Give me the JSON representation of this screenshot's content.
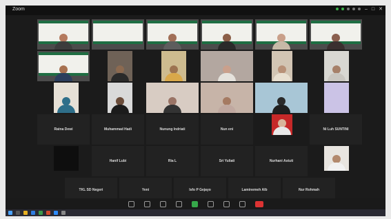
{
  "app": {
    "title": "Zoom"
  },
  "participants": [
    {
      "id": "p1",
      "name": ""
    },
    {
      "id": "p2",
      "name": ""
    },
    {
      "id": "p3",
      "name": ""
    },
    {
      "id": "p4",
      "name": ""
    },
    {
      "id": "p5",
      "name": ""
    },
    {
      "id": "p6",
      "name": ""
    },
    {
      "id": "p7",
      "name": ""
    },
    {
      "id": "p8",
      "name": ""
    },
    {
      "id": "p9",
      "name": ""
    },
    {
      "id": "p10",
      "name": ""
    },
    {
      "id": "p11",
      "name": ""
    },
    {
      "id": "p12",
      "name": ""
    },
    {
      "id": "p13",
      "name": ""
    },
    {
      "id": "p14",
      "name": ""
    },
    {
      "id": "p15",
      "name": ""
    },
    {
      "id": "p16",
      "name": ""
    },
    {
      "id": "p17",
      "name": ""
    },
    {
      "id": "p18",
      "name": ""
    }
  ],
  "name_only": [
    "Ratna Dewi",
    "Muhammad Hadi",
    "Nunung Indriati",
    "Nun eni",
    "",
    "Ni Luh SUNTINI",
    "Hanif Lubi",
    "Ria L",
    "Sri Yuliati",
    "Nurhani Astuti",
    "TKL SD Negeri",
    "Yeni",
    "Isfo P Gejayo",
    "Laminemeh Alb",
    "Nur Rohmah"
  ],
  "colors": {
    "frame_green": "#1f6e43",
    "record_green": "#3cb24a",
    "end_red": "#d33333"
  }
}
